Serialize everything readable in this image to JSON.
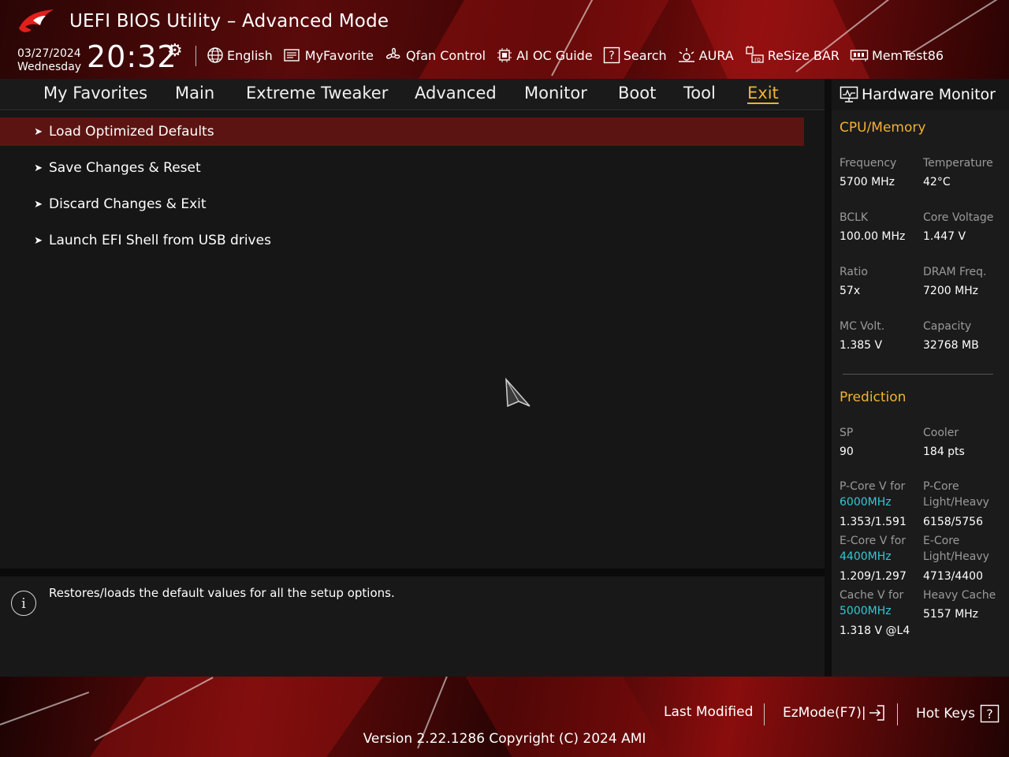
{
  "header": {
    "title": "UEFI BIOS Utility – Advanced Mode",
    "date": "03/27/2024",
    "weekday": "Wednesday",
    "time": "20:32",
    "toolbar": [
      {
        "label": "English",
        "icon": "globe-icon"
      },
      {
        "label": "MyFavorite",
        "icon": "favorite-icon"
      },
      {
        "label": "Qfan Control",
        "icon": "fan-icon"
      },
      {
        "label": "AI OC Guide",
        "icon": "ai-oc-icon"
      },
      {
        "label": "Search",
        "icon": "search-icon"
      },
      {
        "label": "AURA",
        "icon": "aura-icon"
      },
      {
        "label": "ReSize BAR",
        "icon": "resize-bar-icon"
      },
      {
        "label": "MemTest86",
        "icon": "memtest-icon"
      }
    ]
  },
  "tabs": [
    "My Favorites",
    "Main",
    "Extreme Tweaker",
    "Advanced",
    "Monitor",
    "Boot",
    "Tool",
    "Exit"
  ],
  "active_tab": "Exit",
  "menu": [
    {
      "label": "Load Optimized Defaults",
      "selected": true
    },
    {
      "label": "Save Changes & Reset",
      "selected": false
    },
    {
      "label": "Discard Changes & Exit",
      "selected": false
    },
    {
      "label": "Launch EFI Shell from USB drives",
      "selected": false
    }
  ],
  "help": {
    "text": "Restores/loads the default values for all the setup options."
  },
  "hw_monitor": {
    "title": "Hardware Monitor",
    "cpu_memory": {
      "heading": "CPU/Memory",
      "frequency_label": "Frequency",
      "frequency": "5700 MHz",
      "temperature_label": "Temperature",
      "temperature": "42°C",
      "bclk_label": "BCLK",
      "bclk": "100.00 MHz",
      "core_voltage_label": "Core Voltage",
      "core_voltage": "1.447 V",
      "ratio_label": "Ratio",
      "ratio": "57x",
      "dram_freq_label": "DRAM Freq.",
      "dram_freq": "7200 MHz",
      "mc_volt_label": "MC Volt.",
      "mc_volt": "1.385 V",
      "capacity_label": "Capacity",
      "capacity": "32768 MB"
    },
    "prediction": {
      "heading": "Prediction",
      "sp_label": "SP",
      "sp": "90",
      "cooler_label": "Cooler",
      "cooler": "184 pts",
      "pcore_v_label": "P-Core V for",
      "pcore_v_freq": "6000MHz",
      "pcore_v": "1.353/1.591",
      "pcore_lh_label1": "P-Core",
      "pcore_lh_label2": "Light/Heavy",
      "pcore_lh": "6158/5756",
      "ecore_v_label": "E-Core V for",
      "ecore_v_freq": "4400MHz",
      "ecore_v": "1.209/1.297",
      "ecore_lh_label1": "E-Core",
      "ecore_lh_label2": "Light/Heavy",
      "ecore_lh": "4713/4400",
      "cache_v_label": "Cache V for",
      "cache_v_freq": "5000MHz",
      "cache_v": "1.318 V @L4",
      "heavy_cache_label": "Heavy Cache",
      "heavy_cache": "5157 MHz"
    }
  },
  "footer": {
    "last_modified": "Last Modified",
    "ezmode": "EzMode(F7)|",
    "hot_keys": "Hot Keys",
    "version": "Version 2.22.1286 Copyright (C) 2024 AMI"
  },
  "colors": {
    "accent": "#f2b233",
    "selected_row": "#5c1412",
    "highlight_freq": "#33c7d6"
  }
}
